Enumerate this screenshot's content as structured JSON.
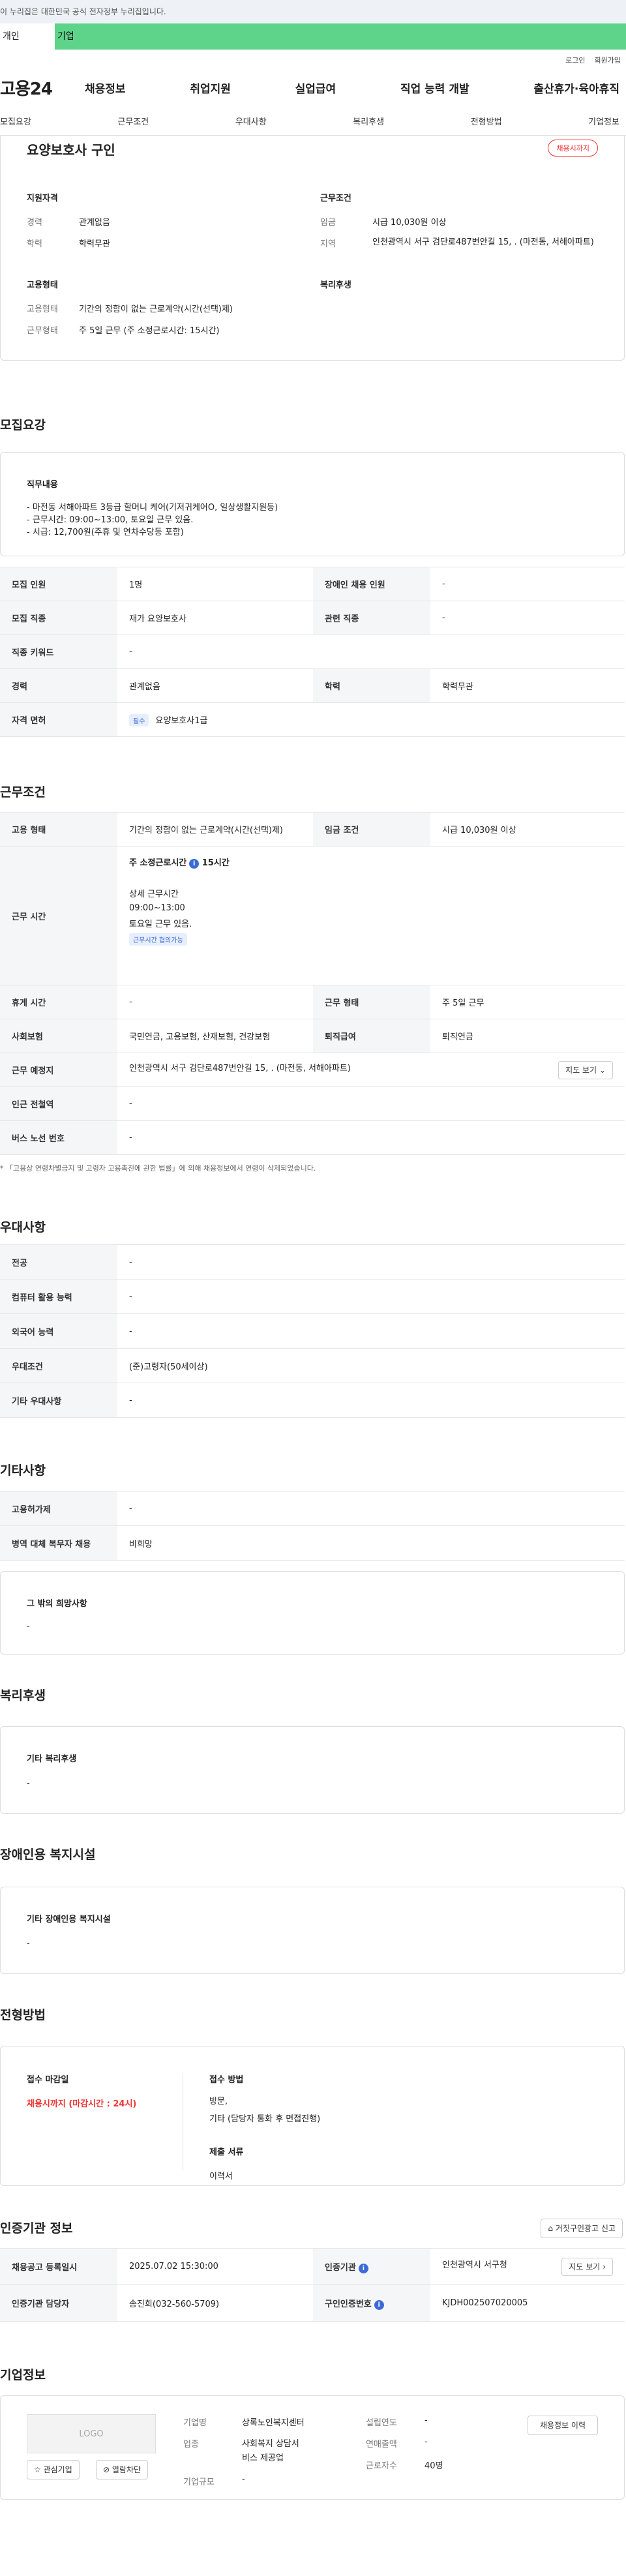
{
  "notice": "이 누리집은 대한민국 공식 전자정부 누리집입니다.",
  "user_tabs": [
    "개인",
    "기업"
  ],
  "top_links": [
    "로그인",
    "회원가입"
  ],
  "logo": "고용24",
  "gnb": [
    "채용정보",
    "취업지원",
    "실업급여",
    "직업 능력 개발",
    "출산휴가·육아휴직"
  ],
  "subnav": [
    "모집요강",
    "근무조건",
    "우대사항",
    "복리후생",
    "전형방법",
    "기업정보"
  ],
  "summary": {
    "title": "요양보호사 구인",
    "badge": "채용시까지",
    "left_head": "지원자격",
    "career_label": "경력",
    "career": "관계없음",
    "edu_label": "학력",
    "edu": "학력무관",
    "right_head": "근무조건",
    "wage_label": "임금",
    "wage": "시급 10,030원 이상",
    "region_label": "지역",
    "region": "인천광역시 서구 검단로487번안길 15, . (마전동, 서해아파트)",
    "emp_head": "고용형태",
    "emp_label": "고용형태",
    "emp": "기간의 정함이 없는 근로계약(시간(선택)제)",
    "work_label": "근무형태",
    "work": "주 5일 근무 (주 소정근로시간: 15시간)",
    "welfare_head": "복리후생"
  },
  "recruit": {
    "title": "모집요강",
    "duty_head": "직무내용",
    "duty_lines": [
      "- 마전동 서해아파트 3등급 할머니 케어(기저귀케어O, 일상생활지원등)",
      "- 근무시간: 09:00~13:00, 토요일 근무 있음.",
      "- 시급: 12,700원(주휴 및 연차수당등 포함)"
    ],
    "rows": [
      {
        "k1": "모집 인원",
        "v1": "1명",
        "k2": "장애인 채용 인원",
        "v2": "-"
      },
      {
        "k1": "모집 직종",
        "v1": "재가 요양보호사",
        "k2": "관련 직종",
        "v2": "-"
      },
      {
        "k1": "직종 키워드",
        "v1": "-"
      },
      {
        "k1": "경력",
        "v1": "관계없음",
        "k2": "학력",
        "v2": "학력무관"
      }
    ],
    "license_label": "자격 면허",
    "license_tag": "필수",
    "license": "요양보호사1급"
  },
  "conditions": {
    "title": "근무조건",
    "emp_label": "고용 형태",
    "emp": "기간의 정함이 없는 근로계약(시간(선택)제)",
    "wage_label": "임금 조건",
    "wage": "시급 10,030원 이상",
    "time_label": "근무 시간",
    "weekly": "주 소정근로시간",
    "weekly_val": "15시간",
    "detail_head": "상세 근무시간",
    "detail_1": "09:00~13:00",
    "detail_2": "토요일 근무 있음.",
    "nego_tag": "근무시간 협의가능",
    "rest_label": "휴게 시간",
    "rest": "-",
    "form_label": "근무 형태",
    "form": "주 5일 근무",
    "ins_label": "사회보험",
    "ins": "국민연금, 고용보험, 산재보험, 건강보험",
    "ret_label": "퇴직급여",
    "ret": "퇴직연금",
    "place_label": "근무 예정지",
    "place": "인천광역시 서구 검단로487번안길 15, . (마전동, 서해아파트)",
    "map_btn": "지도 보기",
    "station_label": "인근 전철역",
    "station": "-",
    "bus_label": "버스 노선 번호",
    "bus": "-",
    "footnote": "* 「고용상 연령차별금지 및 고령자 고용촉진에 관한 법률」에 의해 채용정보에서 연령이 삭제되었습니다."
  },
  "pref": {
    "title": "우대사항",
    "rows": [
      {
        "k": "전공",
        "v": "-"
      },
      {
        "k": "컴퓨터 활용 능력",
        "v": "-"
      },
      {
        "k": "외국어 능력",
        "v": "-"
      },
      {
        "k": "우대조건",
        "v": "(준)고령자(50세이상)"
      },
      {
        "k": "기타 우대사항",
        "v": "-"
      }
    ]
  },
  "etc": {
    "title": "기타사항",
    "rows": [
      {
        "k": "고용허가제",
        "v": "-"
      },
      {
        "k": "병역 대체 복무자 채용",
        "v": "비희망"
      }
    ],
    "other_head": "그 밖의 희망사항",
    "other": "-"
  },
  "welfare": {
    "title": "복리후생",
    "head": "기타 복리후생",
    "value": "-"
  },
  "disab": {
    "title": "장애인용 복지시설",
    "head": "기타 장애인용 복지시설",
    "value": "-"
  },
  "selection": {
    "title": "전형방법",
    "deadline_head": "접수 마감일",
    "deadline": "채용시까지 (마감시간 : 24시)",
    "method_head": "접수 방법",
    "method_1": "방문,",
    "method_2": "기타 (담당자 통화 후 면접진행)",
    "docs_head": "제출 서류",
    "docs": "이력서"
  },
  "cert": {
    "title": "인증기관 정보",
    "report_btn": "거짓구인광고 신고",
    "reg_label": "채용공고 등록일시",
    "reg": "2025.07.02 15:30:00",
    "org_label": "인증기관",
    "org": "인천광역시 서구청",
    "map_btn": "지도 보기",
    "manager_label": "인증기관 담당자",
    "manager": "송진희(032-560-5709)",
    "cert_no_label": "구인인증번호",
    "cert_no": "KJDH002507020005"
  },
  "company": {
    "title": "기업정보",
    "logo": "LOGO",
    "fav_btn": "관심기업",
    "block_btn": "열람차단",
    "name_label": "기업명",
    "name": "상록노인복지센터",
    "industry_label": "업종",
    "industry_1": "사회복지 상담서",
    "industry_2": "비스 제공업",
    "size_label": "기업규모",
    "size": "-",
    "founded_label": "설립연도",
    "founded": "-",
    "sales_label": "연매출액",
    "sales": "-",
    "staff_label": "근로자수",
    "staff": "40명",
    "history_btn": "채용정보 이력"
  }
}
